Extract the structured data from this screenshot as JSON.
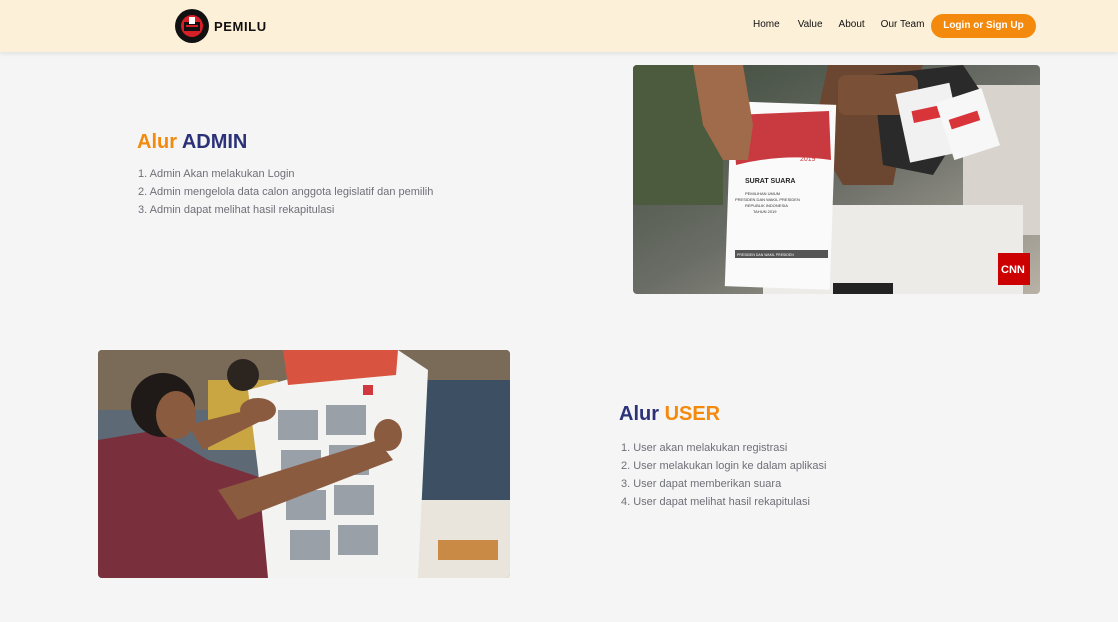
{
  "navbar": {
    "brand": "PEMILU",
    "logo_icon": "ballot-box-logo-icon",
    "links": [
      "Home",
      "Value",
      "About",
      "Our Team"
    ],
    "login_label": "Login or Sign Up"
  },
  "admin": {
    "title_prefix": "Alur",
    "title_highlight": "ADMIN",
    "steps": [
      "1. Admin Akan melakukan Login",
      "2. Admin mengelola data calon anggota legislatif dan pemilih",
      "3. Admin dapat melihat hasil rekapitulasi"
    ],
    "photo": {
      "ballot_heading": "SURAT SUARA",
      "ballot_lines": [
        "PEMILIHAN UMUM",
        "PRESIDEN DAN WAKIL PRESIDEN",
        "REPUBLIK INDONESIA",
        "TAHUN 2019"
      ],
      "ballot_year": "2019",
      "ballot_footer": "PRESIDEN DAN WAKIL PRESIDEN",
      "watermark": "CNN"
    }
  },
  "user": {
    "title_prefix": "Alur",
    "title_highlight": "USER",
    "steps": [
      "1. User akan melakukan registrasi",
      "2. User melakukan login ke dalam aplikasi",
      "3. User dapat memberikan suara",
      "4. User dapat melihat hasil rekapitulasi"
    ]
  },
  "colors": {
    "accent": "#f48a0d",
    "navy": "#2c3278",
    "navbar_bg": "#fdf0d9",
    "page_bg": "#f5f5f5"
  }
}
